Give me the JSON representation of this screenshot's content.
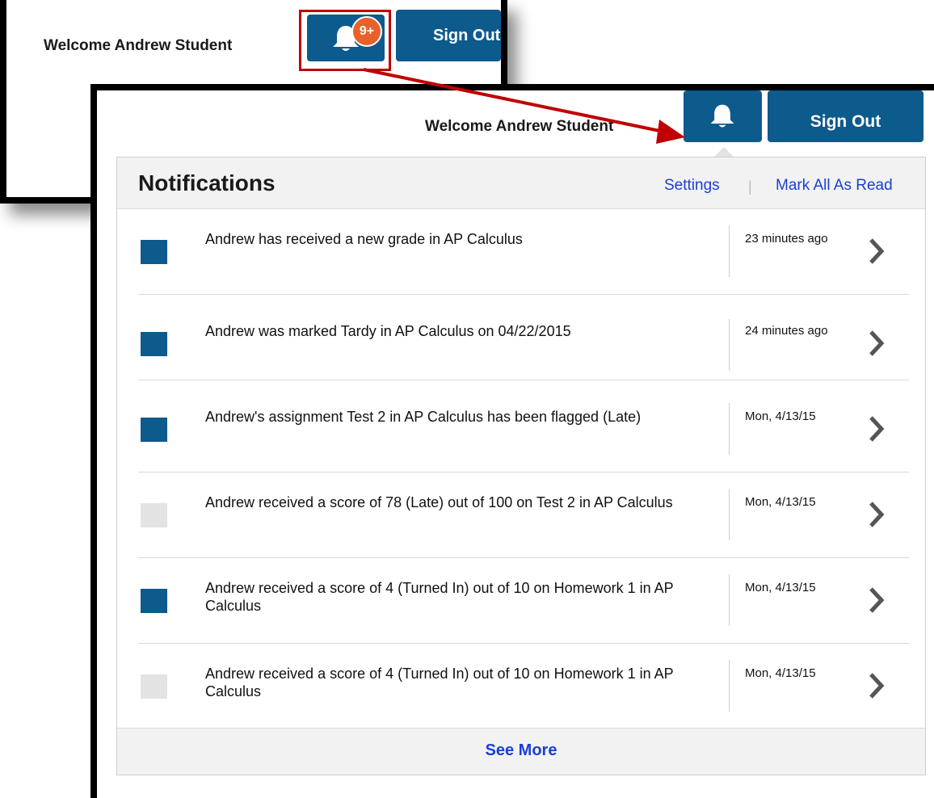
{
  "back_header": {
    "welcome": "Welcome Andrew Student",
    "badge": "9+",
    "signout": "Sign Out"
  },
  "front_header": {
    "welcome": "Welcome Andrew Student",
    "signout": "Sign Out"
  },
  "notifications": {
    "title": "Notifications",
    "settings": "Settings",
    "separator": "|",
    "mark_all": "Mark All As Read",
    "see_more": "See More",
    "items": [
      {
        "text": "Andrew has received a new grade in AP Calculus",
        "time": "23 minutes ago",
        "unread": true
      },
      {
        "text": "Andrew was marked Tardy in AP Calculus on 04/22/2015",
        "time": "24 minutes ago",
        "unread": true
      },
      {
        "text": "Andrew's assignment Test 2 in AP Calculus has been flagged (Late)",
        "time": "Mon, 4/13/15",
        "unread": true
      },
      {
        "text": "Andrew received a score of 78 (Late) out of 100 on Test 2 in AP Calculus",
        "time": "Mon, 4/13/15",
        "unread": false
      },
      {
        "text": "Andrew received a score of 4 (Turned In) out of 10 on Homework 1 in AP Calculus",
        "time": "Mon, 4/13/15",
        "unread": true
      },
      {
        "text": "Andrew received a score of 4 (Turned In) out of 10 on Homework 1 in AP Calculus",
        "time": "Mon, 4/13/15",
        "unread": false
      }
    ]
  },
  "colors": {
    "brand_blue": "#0d5a8d",
    "badge_orange": "#e8612b",
    "link_blue": "#1a3fd4",
    "unread_square": "#0d5a8d",
    "read_square": "#e3e3e3",
    "callout_red": "#c00000"
  },
  "icons": {
    "bell": "bell-icon",
    "chevron": "chevron-right-icon"
  }
}
